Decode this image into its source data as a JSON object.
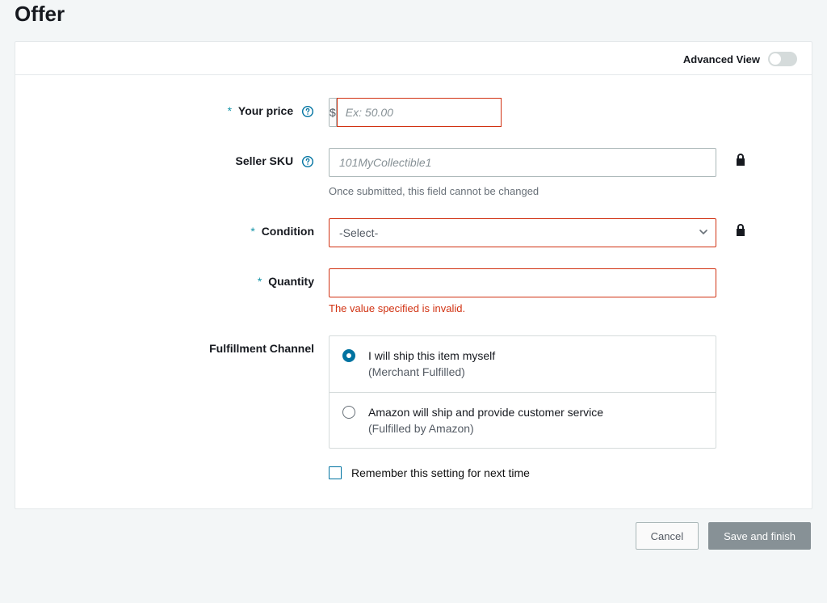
{
  "page_title": "Offer",
  "advanced_view_label": "Advanced View",
  "advanced_view_on": false,
  "required_marker": "*",
  "fields": {
    "price": {
      "label": "Your price",
      "currency": "$",
      "placeholder": "Ex: 50.00",
      "value": ""
    },
    "sku": {
      "label": "Seller SKU",
      "placeholder": "101MyCollectible1",
      "value": "",
      "help": "Once submitted, this field cannot be changed"
    },
    "condition": {
      "label": "Condition",
      "selected": "-Select-"
    },
    "quantity": {
      "label": "Quantity",
      "value": "",
      "error": "The value specified is invalid."
    },
    "fulfillment": {
      "label": "Fulfillment Channel",
      "options": [
        {
          "line1": "I will ship this item myself",
          "line2": "(Merchant Fulfilled)",
          "checked": true
        },
        {
          "line1": "Amazon will ship and provide customer service",
          "line2": "(Fulfilled by Amazon)",
          "checked": false
        }
      ],
      "remember_label": "Remember this setting for next time"
    }
  },
  "buttons": {
    "cancel": "Cancel",
    "save": "Save and finish"
  }
}
